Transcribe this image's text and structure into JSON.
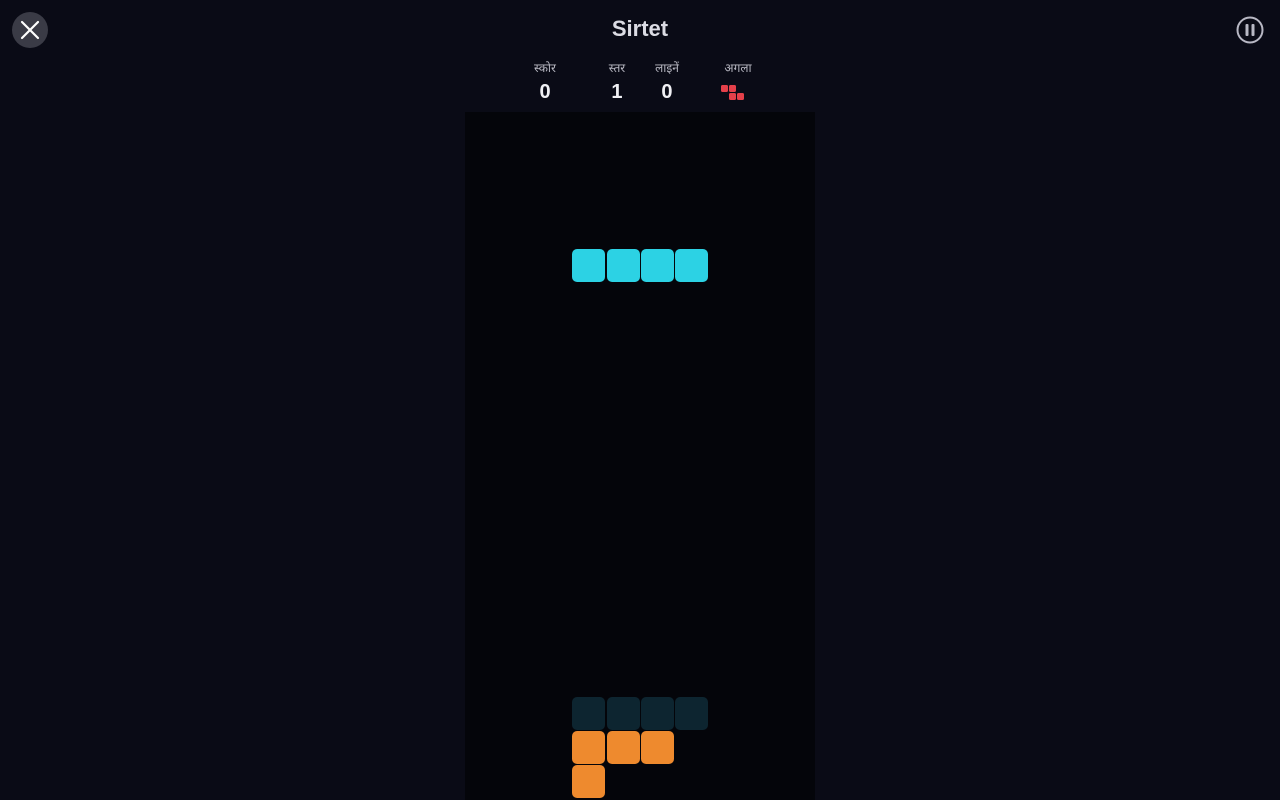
{
  "game": {
    "title": "Sirtet"
  },
  "stats": {
    "score": {
      "label": "स्कोर",
      "value": "0"
    },
    "level": {
      "label": "स्तर",
      "value": "1"
    },
    "lines": {
      "label": "लाइनें",
      "value": "0"
    },
    "next": {
      "label": "अगला"
    }
  },
  "icons": {
    "close": "close-icon",
    "pause": "pause-icon"
  },
  "colors": {
    "background": "#0a0b16",
    "board": "#04050a",
    "active_piece": "#2cd2e4",
    "ghost_piece": "#0d2530",
    "locked_piece": "#ee8a2e",
    "next_piece": "#e5404a"
  },
  "board": {
    "columns": 10,
    "active_piece": {
      "type": "I",
      "cells": [
        [
          3,
          4
        ],
        [
          4,
          4
        ],
        [
          5,
          4
        ],
        [
          6,
          4
        ]
      ]
    },
    "ghost_piece": {
      "cells": [
        [
          3,
          17
        ],
        [
          4,
          17
        ],
        [
          5,
          17
        ],
        [
          6,
          17
        ]
      ]
    },
    "locked_cells": [
      [
        3,
        18
      ],
      [
        4,
        18
      ],
      [
        5,
        18
      ],
      [
        3,
        19
      ]
    ]
  },
  "next_piece": {
    "type": "Z"
  }
}
